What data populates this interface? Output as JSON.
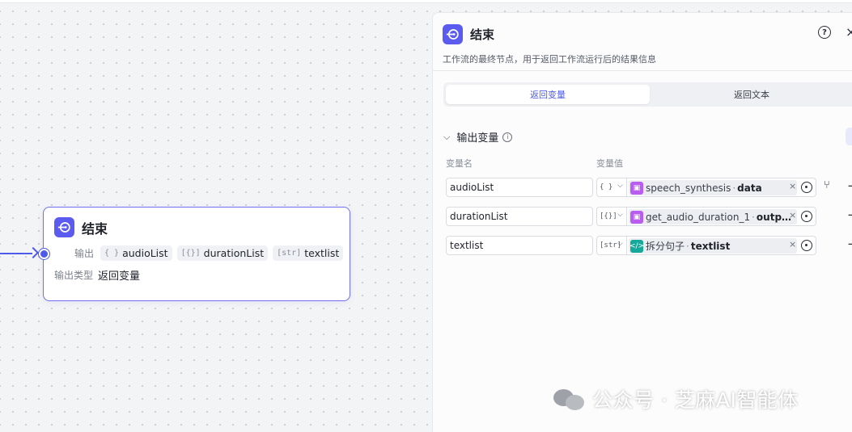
{
  "canvas": {
    "node": {
      "title": "结束",
      "output_label": "输出",
      "outputs": [
        {
          "type": "{ }",
          "name": "audioList"
        },
        {
          "type": "[{}]",
          "name": "durationList"
        },
        {
          "type": "[str]",
          "name": "textlist"
        }
      ],
      "output_type_label": "输出类型",
      "output_type_value": "返回变量"
    }
  },
  "panel": {
    "title": "结束",
    "help": "?",
    "close": "×",
    "description": "工作流的最终节点，用于返回工作流运行后的结果信息",
    "tabs": [
      {
        "label": "返回变量",
        "active": true
      },
      {
        "label": "返回文本",
        "active": false
      }
    ],
    "section_title": "输出变量",
    "info": "i",
    "col_name": "变量名",
    "col_value": "变量值",
    "rows": [
      {
        "name": "audioList",
        "type": "{ }",
        "node_name": "speech_synthesis",
        "sep": "·",
        "field": "data",
        "node_icon_color": "#b95cf0",
        "node_icon": "▣"
      },
      {
        "name": "durationList",
        "type": "[{}]",
        "node_name": "get_audio_duration_1",
        "sep": "·",
        "field": "outp…",
        "node_icon_color": "#b95cf0",
        "node_icon": "▣"
      },
      {
        "name": "textlist",
        "type": "[str]",
        "node_name": "拆分句子",
        "sep": "·",
        "field": "textlist",
        "node_icon_color": "#16a89b",
        "node_icon": "</>"
      }
    ],
    "clear": "×",
    "dropdown": "⌵",
    "branch": "⑂",
    "minus": "−"
  },
  "watermark": {
    "text": "公众号 · 芝麻AI智能体"
  },
  "colors": {
    "accent": "#4e5ae8",
    "brand": "#5b5bf0"
  }
}
